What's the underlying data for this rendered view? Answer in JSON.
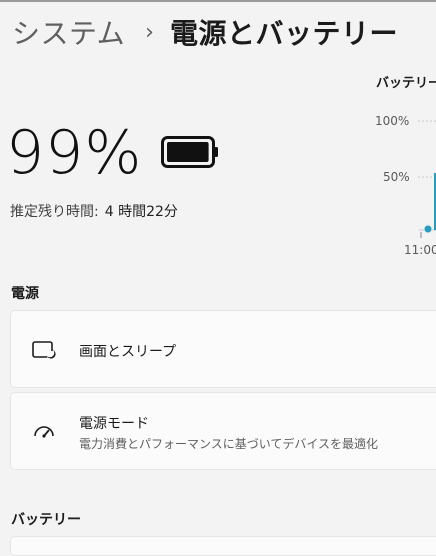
{
  "breadcrumb": {
    "parent": "システム",
    "separator": "›",
    "current": "電源とバッテリー"
  },
  "battery": {
    "percent": "99%",
    "level": 0.99,
    "remaining_label": "推定残り時間:",
    "remaining_value": "4 時間22分"
  },
  "chart": {
    "title": "バッテリー",
    "y_ticks": [
      "100%",
      "50%"
    ],
    "x_tick": "11:00"
  },
  "chart_data": {
    "type": "line",
    "title": "バッテリー",
    "y_ticks": [
      "100%",
      "50%"
    ],
    "x_ticks": [
      "11:00"
    ],
    "ylim": [
      0,
      100
    ],
    "grid": true
  },
  "power_section": {
    "heading": "電源",
    "screen_sleep": {
      "label": "画面とスリープ",
      "icon": "screen-sleep-icon"
    },
    "power_mode": {
      "label": "電源モード",
      "description": "電力消費とパフォーマンスに基づいてデバイスを最適化",
      "icon": "gauge-icon"
    }
  },
  "battery_section": {
    "heading": "バッテリー"
  },
  "colors": {
    "accent": "#2a9bbd",
    "background": "#f3f3f3",
    "card": "#fbfbfb"
  }
}
